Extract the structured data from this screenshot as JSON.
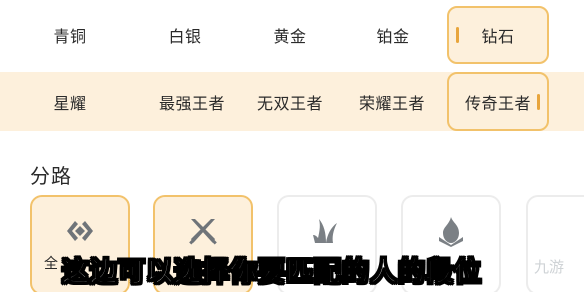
{
  "ranks_row1": {
    "bronze": "青铜",
    "silver": "白银",
    "gold": "黄金",
    "platinum": "铂金",
    "diamond": "钻石"
  },
  "ranks_row2": {
    "starlight": "星耀",
    "strongest_king": "最强王者",
    "peerless_king": "无双王者",
    "glory_king": "荣耀王者",
    "legend_king": "传奇王者"
  },
  "selected": [
    "钻石",
    "传奇王者"
  ],
  "section": {
    "title": "分路"
  },
  "lanes": {
    "all_label": "全"
  },
  "subtitle": "这边可以选择你要匹配的人的段位",
  "watermark": "九游",
  "colors": {
    "selected_fill": "#fdf0dc",
    "selected_border": "#f2c26b",
    "accent": "#e8a53c"
  }
}
